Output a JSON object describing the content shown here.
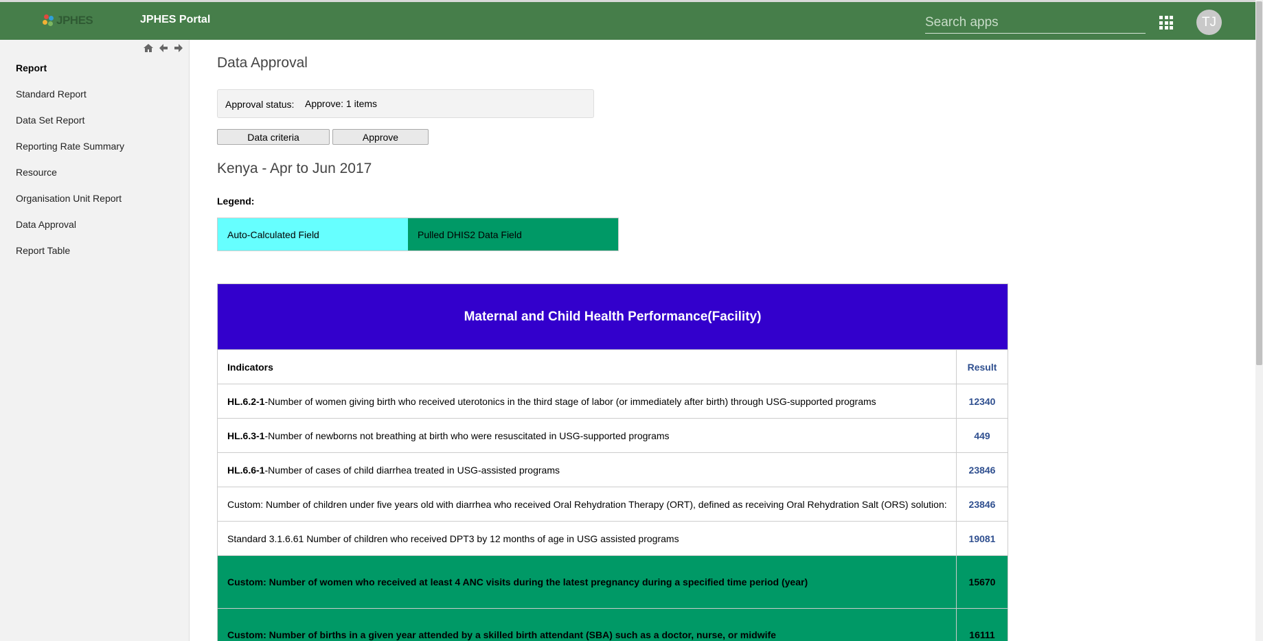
{
  "header": {
    "logo_text": "JPHES",
    "portal_title": "JPHES Portal",
    "search_placeholder": "Search apps",
    "avatar_initials": "TJ",
    "bg_color": "#467e4a"
  },
  "sidebar": {
    "heading": "Report",
    "items": [
      {
        "label": "Standard Report"
      },
      {
        "label": "Data Set Report"
      },
      {
        "label": "Reporting Rate Summary"
      },
      {
        "label": "Resource"
      },
      {
        "label": "Organisation Unit Report"
      },
      {
        "label": "Data Approval"
      },
      {
        "label": "Report Table"
      }
    ],
    "nav_icons": [
      "home-icon",
      "arrow-left-icon",
      "arrow-right-icon"
    ]
  },
  "main": {
    "title": "Data Approval",
    "approval_status_label": "Approval status:",
    "approval_status_value": "Approve: 1 items",
    "buttons": {
      "data_criteria": "Data criteria",
      "approve": "Approve"
    },
    "subtitle": "Kenya - Apr to Jun 2017",
    "legend": {
      "label": "Legend:",
      "auto_calculated": "Auto-Calculated Field",
      "auto_calculated_color": "#66ffff",
      "pulled_dhis2": "Pulled DHIS2 Data Field",
      "pulled_dhis2_color": "#009966"
    }
  },
  "table": {
    "title": "Maternal and Child Health Performance(Facility)",
    "title_bg": "#3300cc",
    "col_indicators": "Indicators",
    "col_result": "Result",
    "rows": [
      {
        "code": "HL.6.2-1",
        "text": "-Number of women giving birth who received uterotonics in the third stage of labor (or immediately after birth) through USG-supported programs",
        "result": "12340"
      },
      {
        "code": "HL.6.3-1",
        "text": "-Number of newborns not breathing at birth who were resuscitated in USG-supported programs",
        "result": "449"
      },
      {
        "code": "HL.6.6-1",
        "text": "-Number of cases of child diarrhea treated in USG-assisted programs",
        "result": "23846"
      },
      {
        "code": "",
        "text": "Custom: Number of children under five years old with diarrhea who received Oral Rehydration Therapy (ORT), defined as receiving Oral Rehydration Salt (ORS) solution:",
        "result": "23846"
      },
      {
        "code": "",
        "text": "Standard 3.1.6.61 Number of children who received DPT3 by 12 months of age in USG assisted programs",
        "result": "19081"
      },
      {
        "code": "",
        "text": "Custom: Number of women who received at least 4 ANC visits during the latest pregnancy during a specified time period (year)",
        "result": "15670"
      },
      {
        "code": "",
        "text": "Custom: Number of births in a given year attended by a skilled birth attendant (SBA) such as a doctor, nurse, or midwife",
        "result": "16111"
      }
    ]
  }
}
